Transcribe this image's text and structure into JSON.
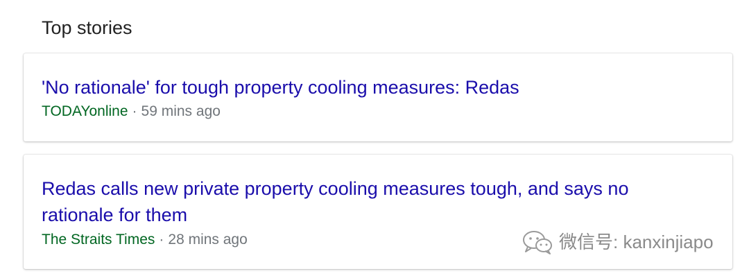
{
  "section": {
    "title": "Top stories"
  },
  "stories": [
    {
      "headline": "'No rationale' for tough property cooling measures: Redas",
      "source": "TODAYonline",
      "separator": "·",
      "time": "59 mins ago"
    },
    {
      "headline": "Redas calls new private property cooling measures tough, and says no rationale for them",
      "source": "The Straits Times",
      "separator": "·",
      "time": "28 mins ago"
    }
  ],
  "watermark": {
    "text": "微信号: kanxinjiapo",
    "icon": "wechat-icon"
  },
  "colors": {
    "headline": "#1a0dab",
    "source": "#006621",
    "meta": "#70757a",
    "title": "#222222"
  }
}
